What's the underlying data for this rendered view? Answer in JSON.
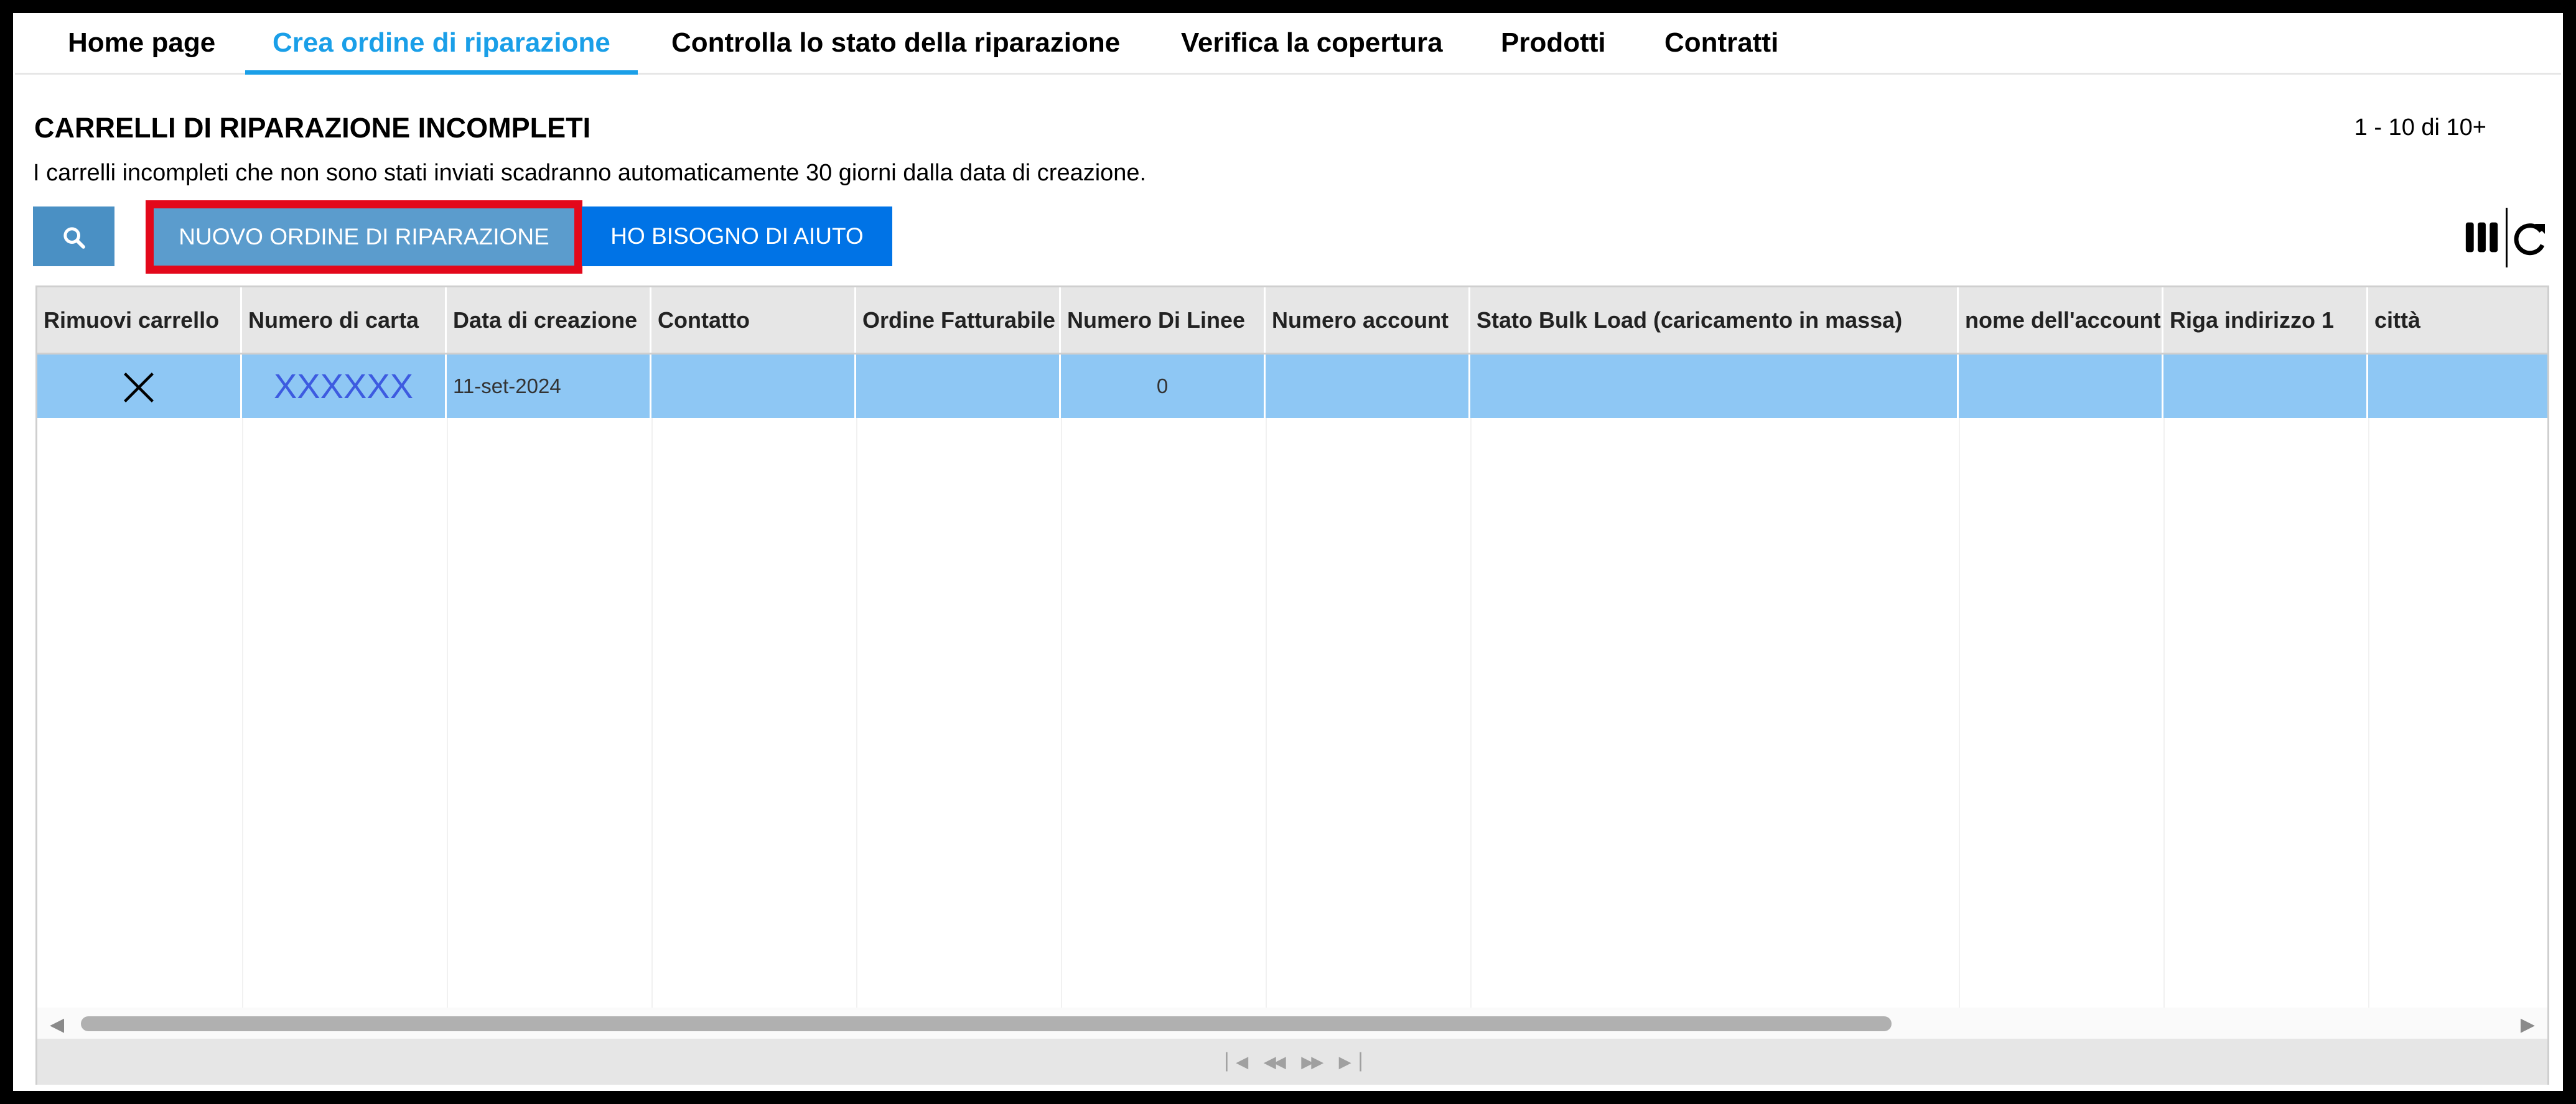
{
  "nav": {
    "tabs": [
      {
        "label": "Home page"
      },
      {
        "label": "Crea ordine di riparazione"
      },
      {
        "label": "Controlla lo stato della riparazione"
      },
      {
        "label": "Verifica la copertura"
      },
      {
        "label": "Prodotti"
      },
      {
        "label": "Contratti"
      }
    ],
    "active_tab": "Crea ordine di riparazione"
  },
  "page": {
    "title": "CARRELLI DI RIPARAZIONE INCOMPLETI",
    "count": "1 - 10 di 10+",
    "description": "I carrelli incompleti che non sono stati inviati scadranno automaticamente 30 giorni dalla data di creazione."
  },
  "toolbar": {
    "search_icon": "search-icon",
    "new_order_label": "NUOVO ORDINE DI RIPARAZIONE",
    "help_label": "HO BISOGNO DI AIUTO",
    "columns_icon": "columns-icon",
    "refresh_icon": "refresh-icon"
  },
  "grid": {
    "columns": [
      "Rimuovi carrello",
      "Numero di carta",
      "Data di creazione",
      "Contatto",
      "Ordine Fatturabile",
      "Numero Di Linee",
      "Numero account",
      "Stato Bulk Load (caricamento in massa)",
      "nome dell'account",
      "Riga indirizzo 1",
      "città"
    ],
    "rows": [
      {
        "remove_icon": "close-icon",
        "numero_di_carta": "XXXXXX",
        "data_di_creazione": "11-set-2024",
        "contatto": "",
        "ordine_fatturabile": "",
        "numero_di_linee": "0",
        "numero_account": "",
        "stato_bulk_load": "",
        "nome_account": "",
        "riga_indirizzo_1": "",
        "citta": ""
      }
    ]
  },
  "colors": {
    "accent": "#1a9fe8",
    "highlight_border": "#e3081b",
    "selected_row": "#8ec7f4",
    "help_button": "#0073e6"
  }
}
